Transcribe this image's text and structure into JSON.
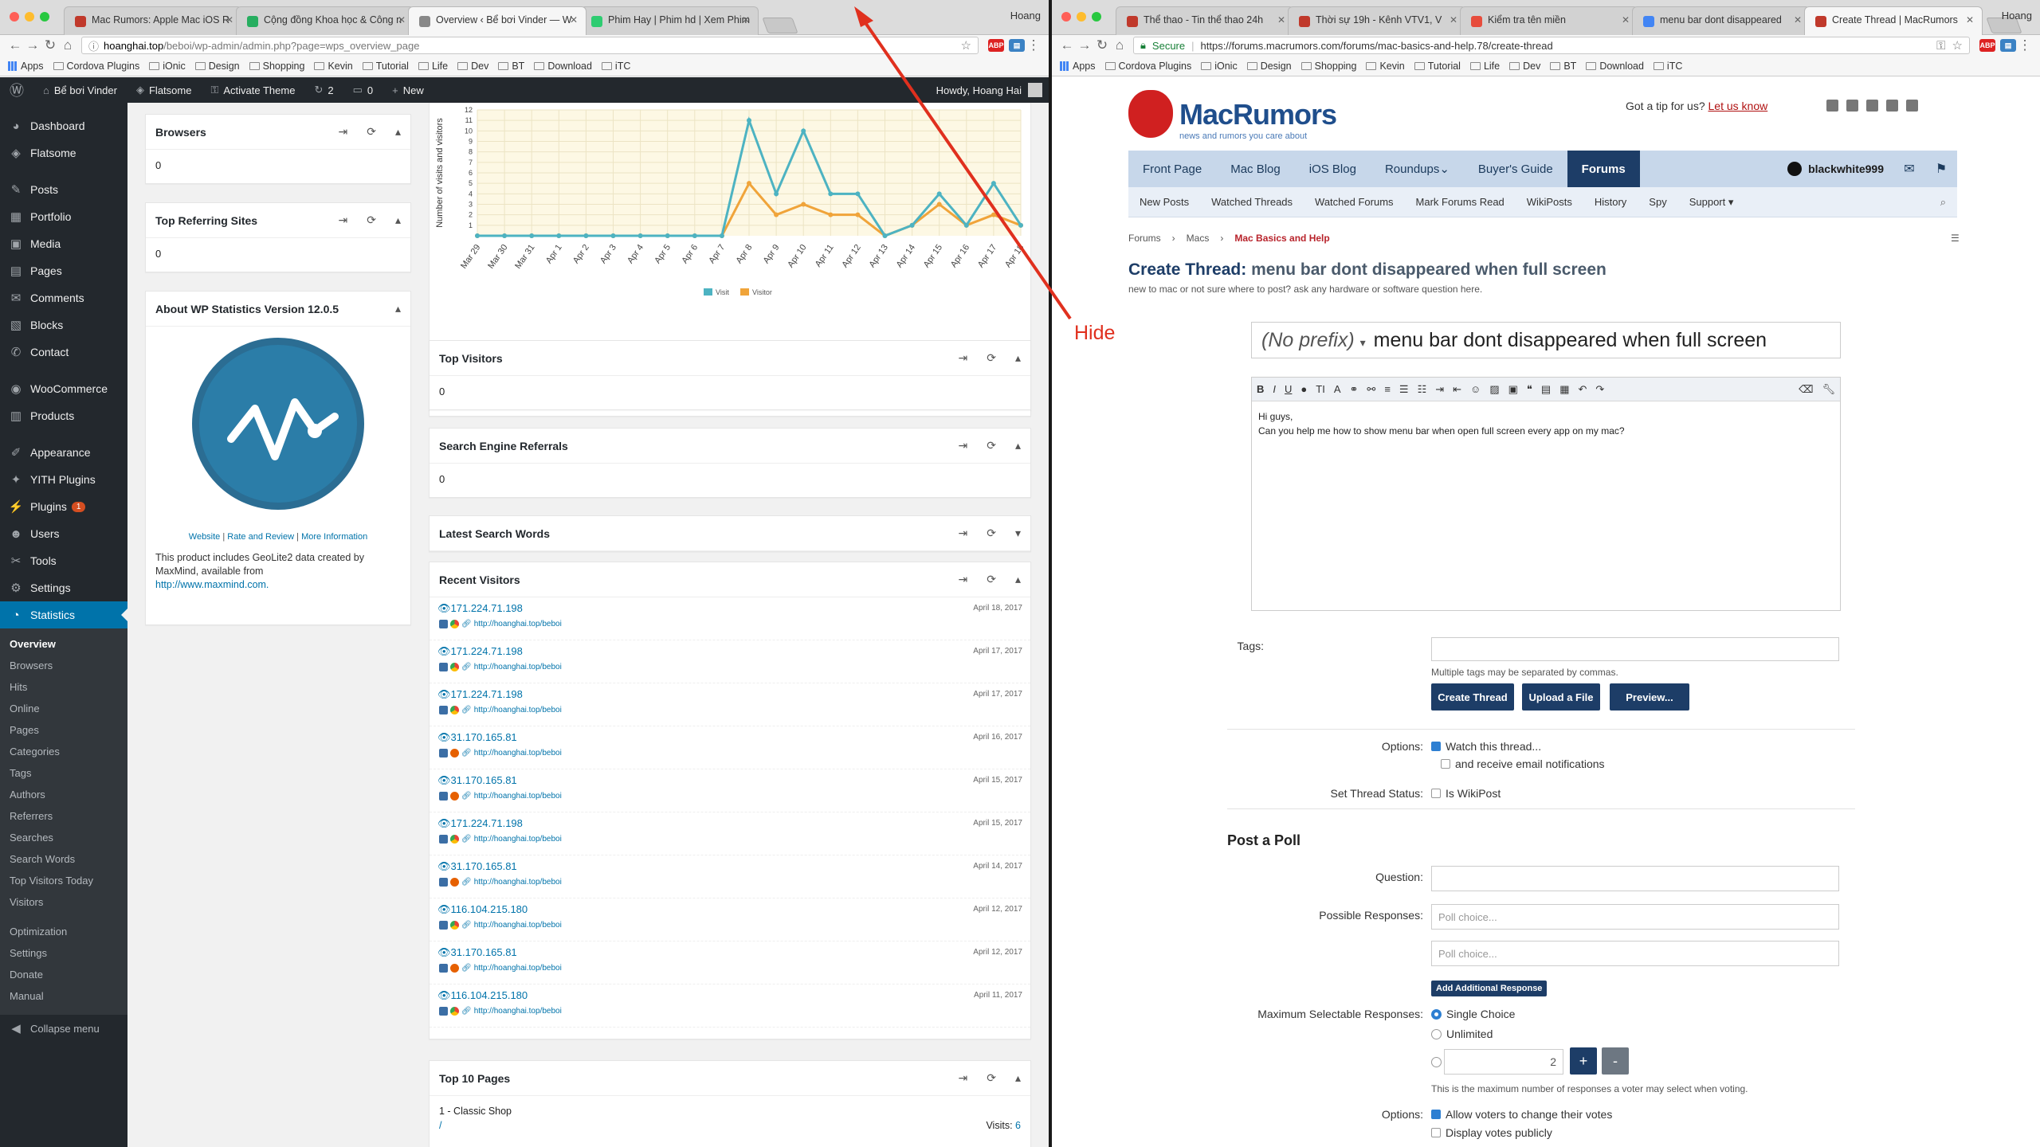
{
  "left_browser": {
    "tabs": [
      {
        "title": "Mac Rumors: Apple Mac iOS R",
        "favicon_color": "#c0392b"
      },
      {
        "title": "Cộng đồng Khoa học & Công n",
        "favicon_color": "#27ae60"
      },
      {
        "title": "Overview ‹ Bể bơi Vinder — W",
        "favicon_color": "#888888"
      },
      {
        "title": "Phim Hay | Phim hd | Xem Phim",
        "favicon_color": "#2ecc71"
      }
    ],
    "profile": "Hoang",
    "address_prefix": "hoanghai.top",
    "address_rest": "/beboi/wp-admin/admin.php?page=wps_overview_page",
    "bookmarks": [
      "Apps",
      "Cordova Plugins",
      "iOnic",
      "Design",
      "Shopping",
      "Kevin",
      "Tutorial",
      "Life",
      "Dev",
      "BT",
      "Download",
      "iTC"
    ]
  },
  "wp": {
    "adminbar": {
      "site": "Bể bơi Vinder",
      "theme": "Flatsome",
      "activate": "Activate Theme",
      "updates": "2",
      "comments": "0",
      "new": "New",
      "howdy": "Howdy, Hoang Hai"
    },
    "menu": [
      {
        "label": "Dashboard",
        "icon": "dashboard-icon",
        "glyph": "◕"
      },
      {
        "label": "Flatsome",
        "icon": "flatsome-icon",
        "glyph": "◈"
      },
      {
        "label": "Posts",
        "icon": "pin-icon",
        "glyph": "✎"
      },
      {
        "label": "Portfolio",
        "icon": "portfolio-icon",
        "glyph": "▦"
      },
      {
        "label": "Media",
        "icon": "media-icon",
        "glyph": "▣"
      },
      {
        "label": "Pages",
        "icon": "pages-icon",
        "glyph": "▤"
      },
      {
        "label": "Comments",
        "icon": "comments-icon",
        "glyph": "✉"
      },
      {
        "label": "Blocks",
        "icon": "blocks-icon",
        "glyph": "▧"
      },
      {
        "label": "Contact",
        "icon": "contact-icon",
        "glyph": "✆"
      },
      {
        "label": "WooCommerce",
        "icon": "woocommerce-icon",
        "glyph": "◉"
      },
      {
        "label": "Products",
        "icon": "products-icon",
        "glyph": "▥"
      },
      {
        "label": "Appearance",
        "icon": "appearance-icon",
        "glyph": "✐"
      },
      {
        "label": "YITH Plugins",
        "icon": "yith-icon",
        "glyph": "✦"
      },
      {
        "label": "Plugins",
        "icon": "plugins-icon",
        "glyph": "⚡",
        "badge": "1"
      },
      {
        "label": "Users",
        "icon": "users-icon",
        "glyph": "☻"
      },
      {
        "label": "Tools",
        "icon": "tools-icon",
        "glyph": "✂"
      },
      {
        "label": "Settings",
        "icon": "settings-icon",
        "glyph": "⚙"
      },
      {
        "label": "Statistics",
        "icon": "statistics-icon",
        "glyph": "◔"
      }
    ],
    "submenu": [
      "Overview",
      "Browsers",
      "Hits",
      "Online",
      "Pages",
      "Categories",
      "Tags",
      "Authors",
      "Referrers",
      "Searches",
      "Search Words",
      "Top Visitors Today",
      "Visitors"
    ],
    "submenu2": [
      "Optimization",
      "Settings",
      "Donate",
      "Manual"
    ],
    "collapse": "Collapse menu",
    "browsers_box": {
      "title": "Browsers",
      "value": "0"
    },
    "referring_box": {
      "title": "Top Referring Sites",
      "value": "0"
    },
    "about_box": {
      "title": "About WP Statistics Version 12.0.5",
      "link_website": "Website",
      "link_rate": "Rate and Review",
      "link_more": "More Information",
      "text": "This product includes GeoLite2 data created by MaxMind, available from",
      "url": "http://www.maxmind.com."
    },
    "top_visitors": {
      "title": "Top Visitors",
      "value": "0"
    },
    "search_referrals": {
      "title": "Search Engine Referrals",
      "value": "0"
    },
    "latest_search": {
      "title": "Latest Search Words"
    },
    "recent_visitors": {
      "title": "Recent Visitors",
      "link": "http://hoanghai.top/beboi",
      "rows": [
        {
          "ip": "171.224.71.198",
          "date": "April 18, 2017",
          "browser": "chrome"
        },
        {
          "ip": "171.224.71.198",
          "date": "April 17, 2017",
          "browser": "chrome"
        },
        {
          "ip": "171.224.71.198",
          "date": "April 17, 2017",
          "browser": "chrome"
        },
        {
          "ip": "31.170.165.81",
          "date": "April 16, 2017",
          "browser": "firefox"
        },
        {
          "ip": "31.170.165.81",
          "date": "April 15, 2017",
          "browser": "firefox"
        },
        {
          "ip": "171.224.71.198",
          "date": "April 15, 2017",
          "browser": "chrome"
        },
        {
          "ip": "31.170.165.81",
          "date": "April 14, 2017",
          "browser": "firefox"
        },
        {
          "ip": "116.104.215.180",
          "date": "April 12, 2017",
          "browser": "chrome"
        },
        {
          "ip": "31.170.165.81",
          "date": "April 12, 2017",
          "browser": "firefox"
        },
        {
          "ip": "116.104.215.180",
          "date": "April 11, 2017",
          "browser": "chrome"
        }
      ]
    },
    "top_pages": {
      "title": "Top 10 Pages",
      "item": "1 - Classic Shop",
      "path": "/",
      "visits_label": "Visits:",
      "visits": "6"
    }
  },
  "chart_data": {
    "type": "line",
    "ylabel": "Number of visits and visitors",
    "ylim": [
      0,
      12
    ],
    "yticks": [
      1,
      2,
      3,
      4,
      5,
      6,
      7,
      8,
      9,
      10,
      11,
      12
    ],
    "categories": [
      "Mar 29",
      "Mar 30",
      "Mar 31",
      "Apr 1",
      "Apr 2",
      "Apr 3",
      "Apr 4",
      "Apr 5",
      "Apr 6",
      "Apr 7",
      "Apr 8",
      "Apr 9",
      "Apr 10",
      "Apr 11",
      "Apr 12",
      "Apr 13",
      "Apr 14",
      "Apr 15",
      "Apr 16",
      "Apr 17",
      "Apr 18"
    ],
    "series": [
      {
        "name": "Visit",
        "color": "#4db3c2",
        "values": [
          0,
          0,
          0,
          0,
          0,
          0,
          0,
          0,
          0,
          0,
          11,
          4,
          10,
          4,
          4,
          0,
          1,
          4,
          1,
          5,
          1
        ]
      },
      {
        "name": "Visitor",
        "color": "#f0a43a",
        "values": [
          0,
          0,
          0,
          0,
          0,
          0,
          0,
          0,
          0,
          0,
          5,
          2,
          3,
          2,
          2,
          0,
          1,
          3,
          1,
          2,
          1
        ]
      }
    ],
    "grid": true,
    "legend": "bottom"
  },
  "right_browser": {
    "tabs": [
      {
        "title": "Thể thao - Tin thể thao 24h",
        "favicon_color": "#c0392b"
      },
      {
        "title": "Thời sự 19h - Kênh VTV1, V",
        "favicon_color": "#c0392b"
      },
      {
        "title": "Kiểm tra tên miền",
        "favicon_color": "#e74c3c"
      },
      {
        "title": "menu bar dont disappeared",
        "favicon_color": "#4285f4"
      },
      {
        "title": "Create Thread | MacRumors",
        "favicon_color": "#c0392b"
      }
    ],
    "profile": "Hoang",
    "secure_label": "Secure",
    "address": "https://forums.macrumors.com/forums/mac-basics-and-help.78/create-thread",
    "bookmarks": [
      "Apps",
      "Cordova Plugins",
      "iOnic",
      "Design",
      "Shopping",
      "Kevin",
      "Tutorial",
      "Life",
      "Dev",
      "BT",
      "Download",
      "iTC"
    ]
  },
  "macrumors": {
    "brand": "MacRumors",
    "tagline": "news and rumors you care about",
    "tip_text": "Got a tip for us?",
    "tip_link": "Let us know",
    "nav": [
      "Front Page",
      "Mac Blog",
      "iOS Blog",
      "Roundups",
      "Buyer's Guide",
      "Forums"
    ],
    "user": "blackwhite999",
    "subnav": [
      "New Posts",
      "Watched Threads",
      "Watched Forums",
      "Mark Forums Read",
      "WikiPosts",
      "History",
      "Spy",
      "Support"
    ],
    "breadcrumbs": [
      "Forums",
      "Macs",
      "Mac Basics and Help"
    ],
    "title_label": "Create Thread:",
    "title_text": "menu bar dont disappeared when full screen",
    "description": "new to mac or not sure where to post? ask any hardware or software question here.",
    "prefix": "(No prefix)",
    "title_value": "menu bar dont disappeared when full screen",
    "body_line1": "Hi guys,",
    "body_line2": "Can you help me how to show menu bar when open full screen every app on my mac?",
    "tags_label": "Tags:",
    "tags_hint": "Multiple tags may be separated by commas.",
    "btn_create": "Create Thread",
    "btn_upload": "Upload a File",
    "btn_preview": "Preview...",
    "options_label": "Options:",
    "opt_watch": "Watch this thread...",
    "opt_email": "and receive email notifications",
    "status_label": "Set Thread Status:",
    "opt_wiki": "Is WikiPost",
    "poll_title": "Post a Poll",
    "question_label": "Question:",
    "responses_label": "Possible Responses:",
    "poll_placeholder": "Poll choice...",
    "add_response": "Add Additional Response",
    "max_label": "Maximum Selectable Responses:",
    "single_choice": "Single Choice",
    "unlimited": "Unlimited",
    "max_value": "2",
    "max_hint": "This is the maximum number of responses a voter may select when voting.",
    "poll_options_label": "Options:",
    "opt_change_votes": "Allow voters to change their votes",
    "opt_public": "Display votes publicly"
  },
  "annotation": {
    "label": "Hide",
    "color": "#e0301e"
  }
}
